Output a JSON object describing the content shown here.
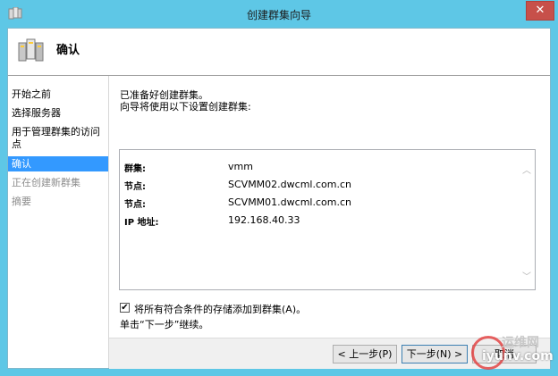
{
  "window": {
    "title": "创建群集向导",
    "close_glyph": "✕"
  },
  "header": {
    "title": "确认",
    "icon": "cluster-servers-icon"
  },
  "nav": {
    "items": [
      {
        "label": "开始之前",
        "state": "normal"
      },
      {
        "label": "选择服务器",
        "state": "normal"
      },
      {
        "label": "用于管理群集的访问点",
        "state": "normal"
      },
      {
        "label": "确认",
        "state": "selected"
      },
      {
        "label": "正在创建新群集",
        "state": "disabled"
      },
      {
        "label": "摘要",
        "state": "disabled"
      }
    ]
  },
  "content": {
    "intro_line1": "已准备好创建群集。",
    "intro_line2": "向导将使用以下设置创建群集:",
    "summary": [
      {
        "label": "群集:",
        "value": "vmm"
      },
      {
        "label": "节点:",
        "value": "SCVMM02.dwcml.com.cn"
      },
      {
        "label": "节点:",
        "value": "SCVMM01.dwcml.com.cn"
      },
      {
        "label": "IP 地址:",
        "value": "192.168.40.33"
      }
    ],
    "checkbox_label": "将所有符合条件的存储添加到群集(A)。",
    "checkbox_checked": true,
    "checkbox_glyph": "✔",
    "hint": "单击“下一步”继续。"
  },
  "buttons": {
    "prev": "< 上一步(P)",
    "next": "下一步(N) >",
    "cancel": "取消"
  },
  "watermark": {
    "text": "运维网",
    "sub": "iyunv.com"
  },
  "colors": {
    "title_bar": "#5ec7e6",
    "selection": "#3399ff",
    "close": "#c7504a"
  }
}
